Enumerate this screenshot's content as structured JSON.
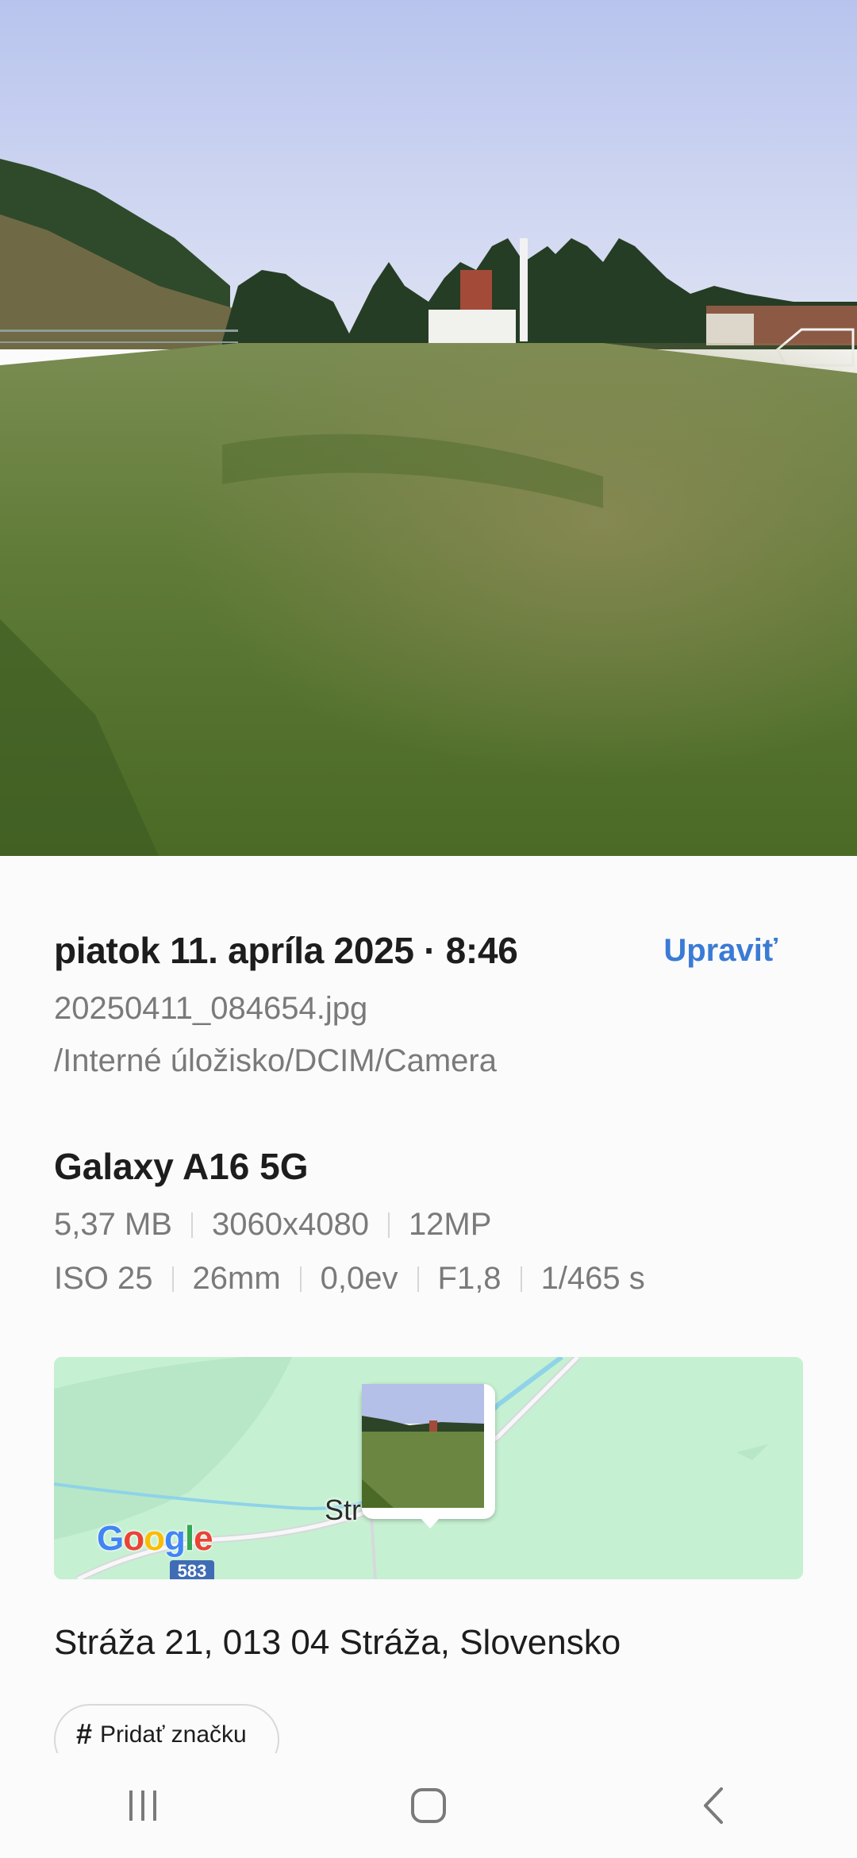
{
  "photo": {
    "description_icon": "landscape-photo"
  },
  "details": {
    "date_time": "piatok 11. apríla 2025 · 8:46",
    "edit_label": "Upraviť",
    "filename": "20250411_084654.jpg",
    "path": "/Interné úložisko/DCIM/Camera",
    "device": "Galaxy A16 5G",
    "specs_row1": [
      "5,37 MB",
      "3060x4080",
      "12MP"
    ],
    "specs_row2": [
      "ISO 25",
      "26mm",
      "0,0ev",
      "F1,8",
      "1/465 s"
    ]
  },
  "map": {
    "place_label": "Str",
    "provider_logo": "Google",
    "road_badge": "583"
  },
  "address": "Stráža 21, 013 04 Stráža, Slovensko",
  "tag_button": {
    "hash_icon": "hash-icon",
    "label": "Pridať značku"
  },
  "nav": [
    "recents-icon",
    "home-icon",
    "back-icon"
  ]
}
